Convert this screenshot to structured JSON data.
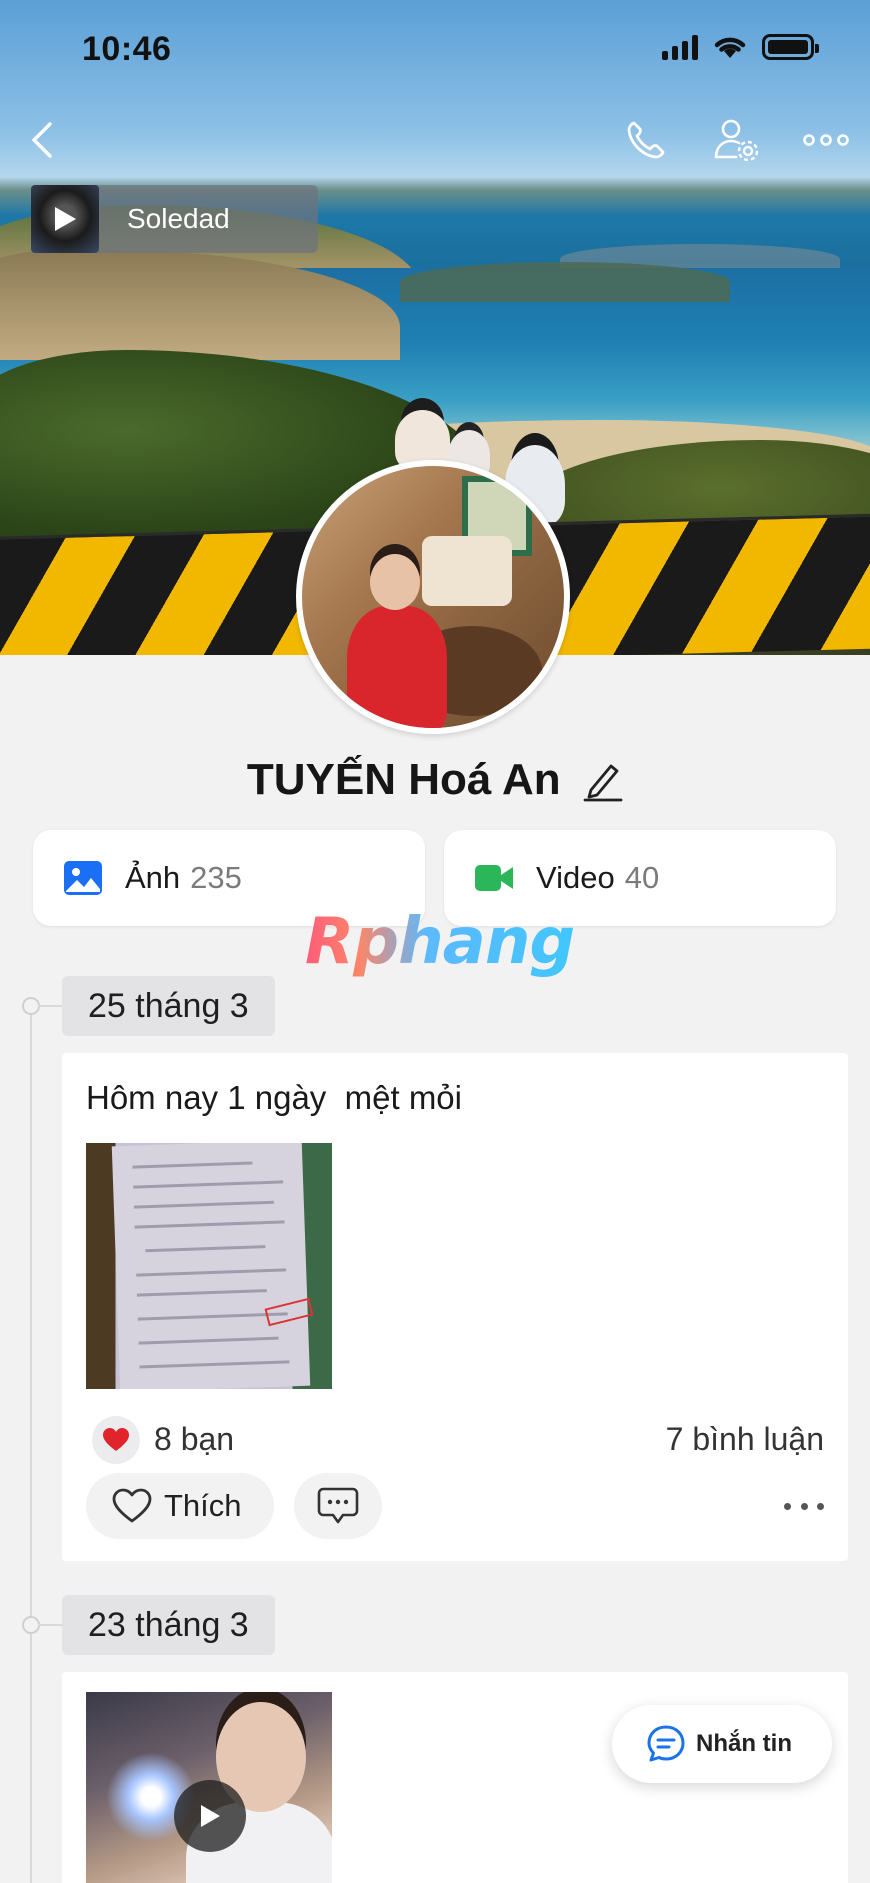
{
  "status_bar": {
    "time": "10:46"
  },
  "music": {
    "title": "Soledad"
  },
  "profile": {
    "name": "TUYẾN Hoá An"
  },
  "media": {
    "photos": {
      "label": "Ảnh",
      "count": "235",
      "icon": "image-icon"
    },
    "videos": {
      "label": "Video",
      "count": "40",
      "icon": "video-camera-icon"
    }
  },
  "watermark": {
    "text": "Rphang"
  },
  "timeline": [
    {
      "date": "25 tháng 3",
      "text": "Hôm nay 1 ngày  mệt mỏi",
      "reactions": "8 bạn",
      "comments": "7 bình luận",
      "like_label": "Thích"
    },
    {
      "date": "23 tháng 3"
    }
  ],
  "fab": {
    "label": "Nhắn tin"
  },
  "colors": {
    "accent": "#1a73e8",
    "heart": "#e0242b",
    "video": "#2bb65a"
  }
}
